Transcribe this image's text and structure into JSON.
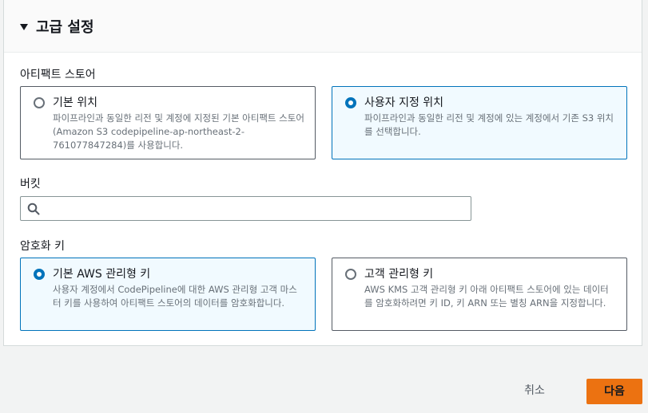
{
  "section": {
    "title": "고급 설정",
    "expanded": true
  },
  "artifact_store": {
    "label": "아티팩트 스토어",
    "options": [
      {
        "title": "기본 위치",
        "description": "파이프라인과 동일한 리전 및 계정에 지정된 기본 아티팩트 스토어(Amazon S3 codepipeline-ap-northeast-2-761077847284)를 사용합니다.",
        "selected": false
      },
      {
        "title": "사용자 지정 위치",
        "description": "파이프라인과 동일한 리전 및 계정에 있는 계정에서 기존 S3 위치를 선택합니다.",
        "selected": true
      }
    ]
  },
  "bucket": {
    "label": "버킷",
    "value": "",
    "placeholder": ""
  },
  "encryption": {
    "label": "암호화 키",
    "options": [
      {
        "title": "기본 AWS 관리형 키",
        "description": "사용자 계정에서 CodePipeline에 대한 AWS 관리형 고객 마스터 키를 사용하여 아티팩트 스토어의 데이터를 암호화합니다.",
        "selected": true
      },
      {
        "title": "고객 관리형 키",
        "description": "AWS KMS 고객 관리형 키 아래 아티팩트 스토어에 있는 데이터를 암호화하려면 키 ID, 키 ARN 또는 별칭 ARN을 지정합니다.",
        "selected": false
      }
    ]
  },
  "footer": {
    "cancel_label": "취소",
    "next_label": "다음"
  },
  "colors": {
    "accent": "#0073bb",
    "primary_button": "#ec7211",
    "selected_tile_bg": "#f1faff"
  }
}
